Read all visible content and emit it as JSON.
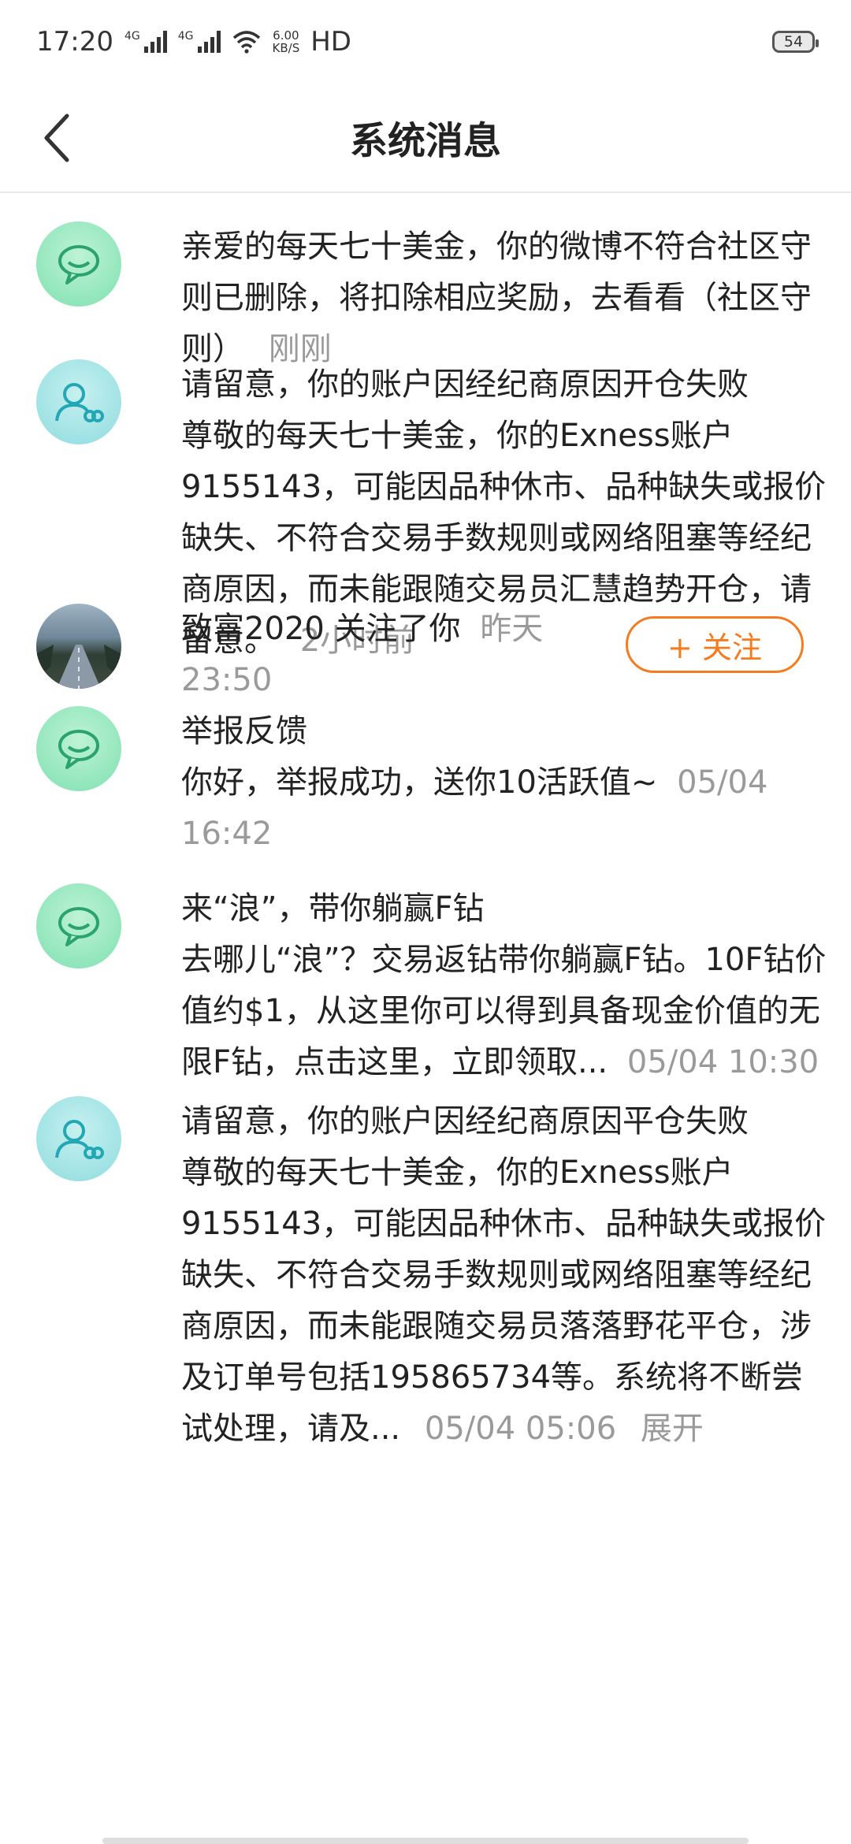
{
  "status_bar": {
    "time": "17:20",
    "net1": "4G",
    "net2": "4G",
    "speed_top": "6.00",
    "speed_bottom": "KB/S",
    "hd": "HD",
    "battery": "54"
  },
  "header": {
    "title": "系统消息"
  },
  "messages": [
    {
      "type": "weibo",
      "text": "亲爱的每天七十美金，你的微博不符合社区守则已删除，将扣除相应奖励，去看看（社区守则）",
      "time": "刚刚"
    },
    {
      "type": "group",
      "title": "请留意，你的账户因经纪商原因开仓失败",
      "text": " 尊敬的每天七十美金，你的Exness账户9155143，可能因品种休市、品种缺失或报价缺失、不符合交易手数规则或网络阻塞等经纪商原因，而未能跟随交易员汇慧趋势开仓，请留意。",
      "time": "2小时前"
    },
    {
      "type": "follow",
      "text": "致富2020 关注了你",
      "time": "昨天 23:50",
      "button": "+ 关注"
    },
    {
      "type": "weibo",
      "title": "举报反馈",
      "text": "你好，举报成功，送你10活跃值~",
      "time": "05/04 16:42"
    },
    {
      "type": "weibo",
      "title": "来“浪”，带你躺赢F钻",
      "text": "去哪儿“浪”？交易返钻带你躺赢F钻。10F钻价值约$1，从这里你可以得到具备现金价值的无限F钻，点击这里，立即领取...",
      "time": "05/04 10:30"
    },
    {
      "type": "group",
      "title": "请留意，你的账户因经纪商原因平仓失败",
      "text": " 尊敬的每天七十美金，你的Exness账户9155143，可能因品种休市、品种缺失或报价缺失、不符合交易手数规则或网络阻塞等经纪商原因，而未能跟随交易员落落野花平仓，涉及订单号包括195865734等。系统将不断尝试处理，请及...",
      "time": "05/04 05:06",
      "expand": "展开"
    }
  ],
  "colors": {
    "accent": "#f47b20",
    "meta": "#9a9a9a",
    "weibo_avatar": "#7fe0b0",
    "group_avatar": "#8fdbe0"
  },
  "icons": {
    "back": "chevron-left-icon",
    "weibo": "weibo-chat-icon",
    "group": "group-icon"
  }
}
